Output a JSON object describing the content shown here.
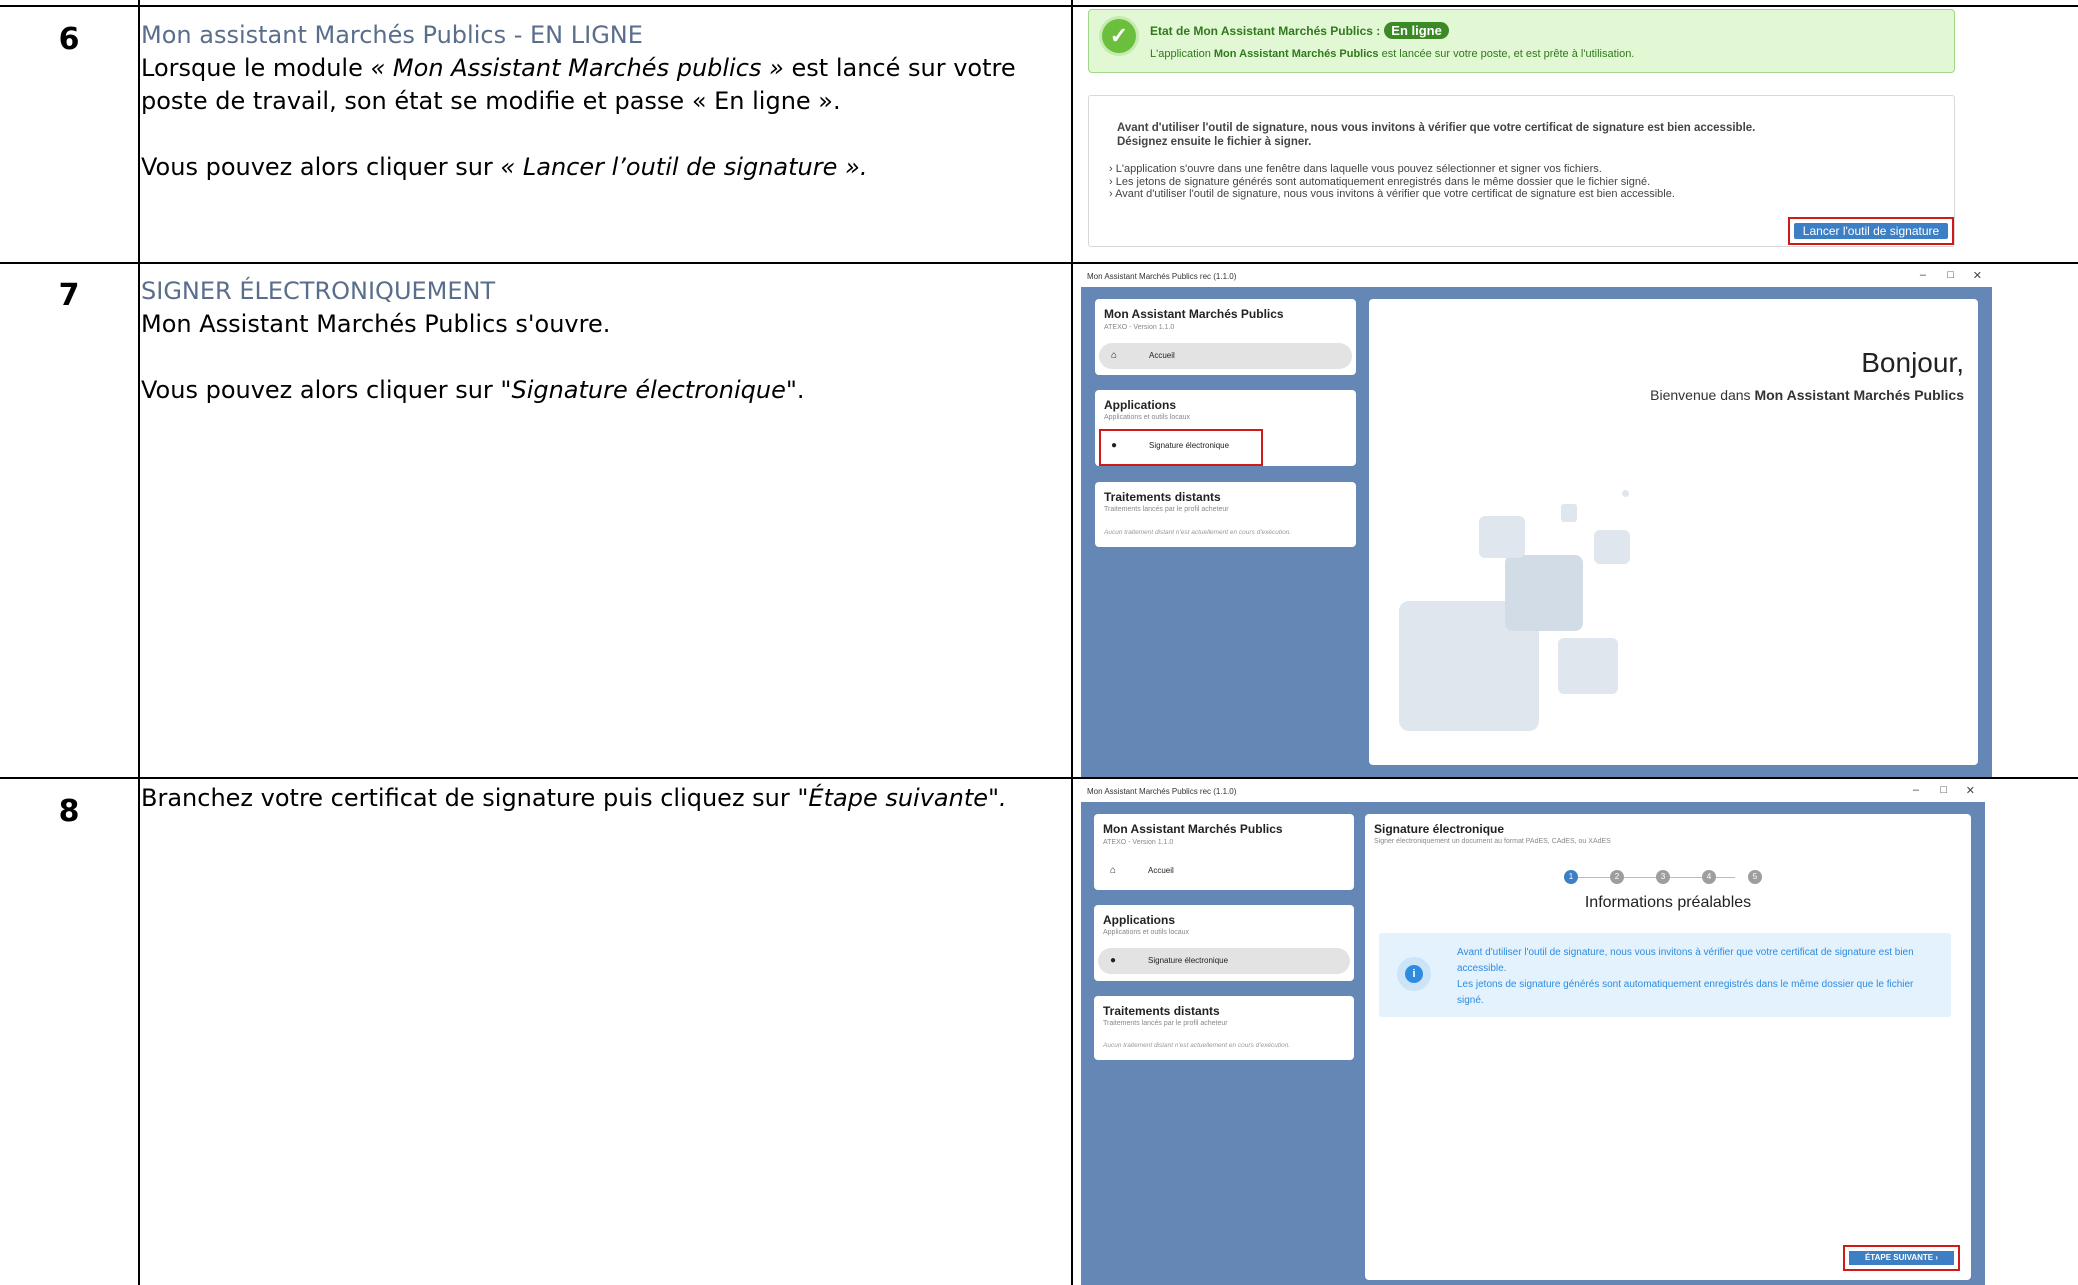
{
  "rows": [
    {
      "number": "6",
      "heading": "Mon assistant Marchés Publics - EN LIGNE",
      "p1_a": "Lorsque le module ",
      "p1_b": "« Mon Assistant Marchés publics »",
      "p1_c": " est lancé sur votre poste de travail, son état se modifie et passe « En ligne ».",
      "p2_a": "Vous pouvez alors cliquer sur ",
      "p2_b": "« Lancer l’outil de signature »."
    },
    {
      "number": "7",
      "heading": "SIGNER ÉLECTRONIQUEMENT",
      "p1": "Mon Assistant Marchés Publics s'ouvre.",
      "p2_a": "Vous pouvez alors cliquer sur ",
      "p2_b": "\"Signature électronique\"",
      "p2_c": "."
    },
    {
      "number": "8",
      "p1_a": "Branchez votre certificat de signature puis cliquez sur ",
      "p1_b": "\"Étape suivante\"."
    }
  ],
  "shot6": {
    "status_label": "Etat de Mon Assistant Marchés Publics :",
    "status_badge": "En ligne",
    "status_line_a": "L'application ",
    "status_line_b": "Mon Assistant Marchés Publics",
    "status_line_c": " est lancée sur votre poste, et est prête à l'utilisation.",
    "intro_1": "Avant d'utiliser l'outil de signature, nous vous invitons à vérifier que votre certificat de signature est bien accessible.",
    "intro_2": "Désignez ensuite le fichier à signer.",
    "bullets": [
      "L'application s'ouvre dans une fenêtre dans laquelle vous pouvez sélectionner et signer vos fichiers.",
      "Les jetons de signature générés sont automatiquement enregistrés dans le même dossier que le fichier signé.",
      "Avant d'utiliser l'outil de signature, nous vous invitons à vérifier que votre certificat de signature est bien accessible."
    ],
    "button": "Lancer l'outil de signature"
  },
  "app": {
    "window_title": "Mon Assistant Marchés Publics rec (1.1.0)",
    "minimize": "–",
    "maximize": "□",
    "close": "✕",
    "app_name": "Mon Assistant Marchés Publics",
    "version": "ATEXO - Version 1.1.0",
    "home": "Accueil",
    "applications": "Applications",
    "applications_sub": "Applications et outils locaux",
    "signature": "Signature électronique",
    "remote": "Traitements distants",
    "remote_sub": "Traitements lancés par le profil acheteur",
    "remote_empty": "Aucun traitement distant n'est actuellement en cours d'exécution."
  },
  "shot7": {
    "greeting": "Bonjour,",
    "welcome_a": "Bienvenue dans ",
    "welcome_b": "Mon Assistant Marchés Publics"
  },
  "shot8": {
    "title": "Signature électronique",
    "subtitle": "Signer électroniquement un document au format PAdES, CAdES, ou XAdES",
    "steps": [
      "1",
      "2",
      "3",
      "4",
      "5"
    ],
    "step_title": "Informations préalables",
    "info_1": "Avant d'utiliser l'outil de signature, nous vous invitons à vérifier que votre certificat de signature est bien accessible.",
    "info_2": "Les jetons de signature générés sont automatiquement enregistrés dans le même dossier que le fichier signé.",
    "next": "ÉTAPE SUIVANTE ›"
  },
  "colors": {
    "heading": "#5a6e8c",
    "window_bg": "#6487b5",
    "highlight": "#d01a1a",
    "online": "#3c8a26"
  }
}
